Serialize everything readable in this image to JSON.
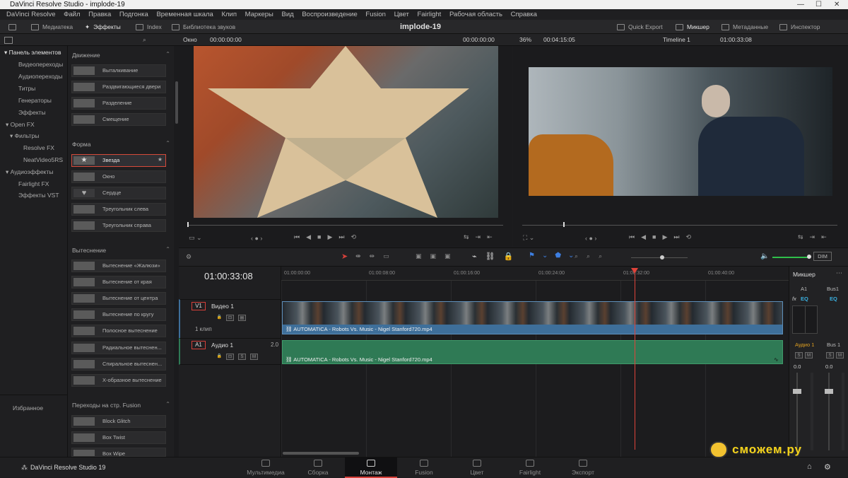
{
  "window": {
    "title": "DaVinci Resolve Studio - implode-19"
  },
  "menu": [
    "DaVinci Resolve",
    "Файл",
    "Правка",
    "Подгонка",
    "Временная шкала",
    "Клип",
    "Маркеры",
    "Вид",
    "Воспроизведение",
    "Fusion",
    "Цвет",
    "Fairlight",
    "Рабочая область",
    "Справка"
  ],
  "toolbar": {
    "media": "Медиатека",
    "effects": "Эффекты",
    "index": "Index",
    "sound_library": "Библиотека звуков",
    "project_title": "implode-19",
    "quick_export": "Quick Export",
    "mixer": "Микшер",
    "metadata": "Метаданные",
    "inspector": "Инспектор"
  },
  "subbar": {
    "window_label": "Окно",
    "src_timecode": "00:00:00:00",
    "src_timecode_right": "00:00:00:00",
    "zoom": "36%",
    "duration": "00:04:15:05",
    "timeline_name": "Timeline 1",
    "timeline_timecode": "01:00:33:08"
  },
  "left_panel": {
    "header": "Панель элементов",
    "items": [
      "Видеопереходы",
      "Аудиопереходы",
      "Титры",
      "Генераторы",
      "Эффекты",
      "Open FX",
      "Фильтры",
      "Resolve FX",
      "NeatVideo5RS",
      "Аудиоэффекты",
      "Fairlight FX",
      "Эффекты VST"
    ],
    "favorites": "Избранное"
  },
  "effects_panel": {
    "groups": [
      {
        "title": "Движение",
        "items": [
          "Выталкивание",
          "Раздвигающиеся двери",
          "Разделение",
          "Смещение"
        ]
      },
      {
        "title": "Форма",
        "items": [
          "Звезда",
          "Окно",
          "Сердце",
          "Треугольник слева",
          "Треугольник справа"
        ]
      },
      {
        "title": "Вытеснение",
        "items": [
          "Вытеснение «Жалюзи»",
          "Вытеснение от края",
          "Вытеснение от центра",
          "Вытеснение по кругу",
          "Полосное вытеснение",
          "Радиальное вытеснен...",
          "Спиральное вытеснен...",
          "Х-образное вытеснение"
        ]
      },
      {
        "title": "Переходы на стр. Fusion",
        "items": [
          "Block Glitch",
          "Box Twist",
          "Box Wipe"
        ]
      }
    ]
  },
  "timeline": {
    "timecode": "01:00:33:08",
    "ruler": [
      "01:00:00:00",
      "01:00:08:00",
      "01:00:16:00",
      "01:00:24:00",
      "01:00:32:00",
      "01:00:40:00"
    ],
    "tracks": [
      {
        "id": "V1",
        "name": "Видео 1",
        "info": "1 клип",
        "clip": "AUTOMATICA - Robots Vs. Music - Nigel Stanford720.mp4"
      },
      {
        "id": "A1",
        "name": "Аудио 1",
        "info": "2.0",
        "clip": "AUTOMATICA - Robots Vs. Music - Nigel Stanford720.mp4"
      }
    ],
    "dim_label": "DIM"
  },
  "mixer": {
    "title": "Микшер",
    "channels": [
      "A1",
      "Bus1"
    ],
    "fx": "fx",
    "eq": "EQ",
    "strip_labels": [
      "Аудио 1",
      "Bus 1"
    ],
    "levels": [
      "0.0",
      "0.0"
    ],
    "button_s": "S",
    "button_m": "M"
  },
  "bottom": {
    "brand": "DaVinci Resolve Studio 19",
    "pages": [
      "Мультимедиа",
      "Сборка",
      "Монтаж",
      "Fusion",
      "Цвет",
      "Fairlight",
      "Экспорт"
    ],
    "watermark": "сможем.ру"
  },
  "colors": {
    "accent_red": "#d6403a",
    "video_clip": "#3e6f9a",
    "audio_clip": "#2f7a55",
    "playhead": "#e0433a"
  }
}
